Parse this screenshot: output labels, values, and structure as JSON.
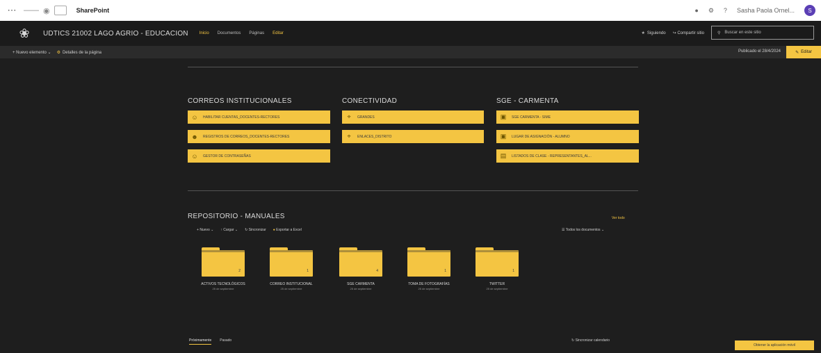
{
  "suitebar": {
    "app_name": "SharePoint",
    "user_name": "Sasha Paola Ornel...",
    "avatar_initial": "S"
  },
  "site": {
    "title": "UDTICS 21002 LAGO AGRIO - EDUCACION",
    "nav": [
      "Inicio",
      "Documentos",
      "Páginas",
      "Editar"
    ],
    "follow_label": "Siguiendo",
    "share_label": "Compartir sitio",
    "search_placeholder": "Buscar en este sitio"
  },
  "commandbar": {
    "new_label": "Nuevo elemento",
    "details_label": "Detalles de la página",
    "published_label": "Publicado el 28/4/2024",
    "edit_label": "Editar"
  },
  "sections": {
    "correos": {
      "title": "CORREOS INSTITUCIONALES",
      "links": [
        "HABILITAR CUENTAS_DOCENTES-RECTORES",
        "REGISTROS DE CORREOS_DOCENTES-RECTORES",
        "GESTOR DE CONTRASEÑAS"
      ]
    },
    "conectividad": {
      "title": "CONECTIVIDAD",
      "links": [
        "GRANDES",
        "ENLACES_DISTRITO"
      ]
    },
    "sge": {
      "title": "SGE - CARMENTA",
      "links": [
        "SGE CARMENTA - SIME",
        "LUGAR DE ASIGNACIÓN - ALUMNO",
        "LISTADOS DE CLASE - REPRESENTANTES_AL..."
      ]
    }
  },
  "repository": {
    "title": "REPOSITORIO - MANUALES",
    "see_all": "Ver todo",
    "toolbar": [
      "Nuevo",
      "Cargar",
      "Sincronizar",
      "Exportar a Excel"
    ],
    "all_docs": "Todos los documentos",
    "folders": [
      {
        "name": "ACTIVOS TECNOLÓGICOS",
        "date": "25 de septiembre",
        "count": "2"
      },
      {
        "name": "CORREO INSTITUCIONAL",
        "date": "25 de septiembre",
        "count": "1"
      },
      {
        "name": "SGE CARMENTA",
        "date": "25 de septiembre",
        "count": "4"
      },
      {
        "name": "TOMA DE FOTOGRAFÍAS",
        "date": "25 de septiembre",
        "count": "1"
      },
      {
        "name": "TWITTER",
        "date": "25 de septiembre",
        "count": "1"
      }
    ]
  },
  "bottom": {
    "tabs": [
      "Próximamente",
      "Pasado"
    ],
    "calendar_action": "Sincronizar calendario",
    "get_app": "Obtener la aplicación móvil"
  },
  "colors": {
    "accent": "#f4c542",
    "background": "#1e1e1e"
  }
}
